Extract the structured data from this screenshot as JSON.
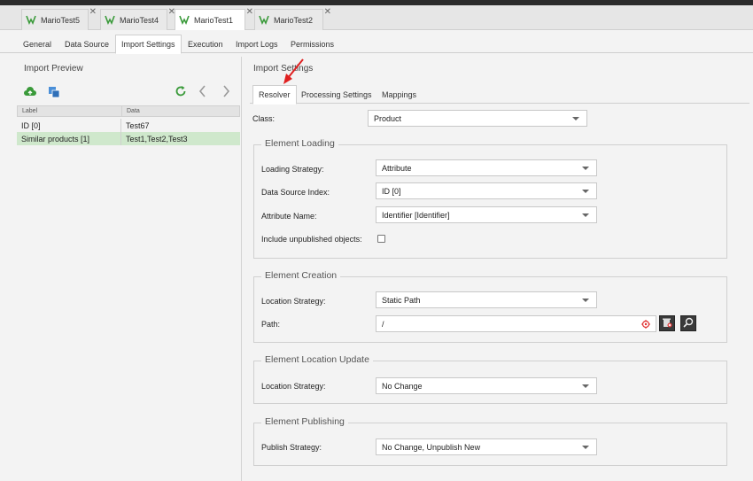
{
  "doc_tabs": [
    {
      "label": "MarioTest5"
    },
    {
      "label": "MarioTest4"
    },
    {
      "label": "MarioTest1"
    },
    {
      "label": "MarioTest2"
    }
  ],
  "sub_tabs": [
    {
      "label": "General"
    },
    {
      "label": "Data Source"
    },
    {
      "label": "Import Settings"
    },
    {
      "label": "Execution"
    },
    {
      "label": "Import Logs"
    },
    {
      "label": "Permissions"
    }
  ],
  "import_preview": {
    "title": "Import Preview",
    "columns": [
      "Label",
      "Data"
    ],
    "rows": [
      {
        "label": "ID [0]",
        "data": "Test67"
      },
      {
        "label": "Similar products [1]",
        "data": "Test1,Test2,Test3"
      }
    ]
  },
  "import_settings": {
    "title": "Import Settings",
    "tabs": [
      {
        "label": "Resolver"
      },
      {
        "label": "Processing Settings"
      },
      {
        "label": "Mappings"
      }
    ],
    "class_label": "Class:",
    "class_value": "Product",
    "element_loading": {
      "legend": "Element Loading",
      "loading_strategy_label": "Loading Strategy:",
      "loading_strategy_value": "Attribute",
      "data_source_index_label": "Data Source Index:",
      "data_source_index_value": "ID [0]",
      "attribute_name_label": "Attribute Name:",
      "attribute_name_value": "Identifier [Identifier]",
      "include_unpublished_label": "Include unpublished objects:"
    },
    "element_creation": {
      "legend": "Element Creation",
      "location_strategy_label": "Location Strategy:",
      "location_strategy_value": "Static Path",
      "path_label": "Path:",
      "path_value": "/"
    },
    "element_location_update": {
      "legend": "Element Location Update",
      "location_strategy_label": "Location Strategy:",
      "location_strategy_value": "No Change"
    },
    "element_publishing": {
      "legend": "Element Publishing",
      "publish_strategy_label": "Publish Strategy:",
      "publish_strategy_value": "No Change, Unpublish New"
    }
  },
  "colors": {
    "accent_green": "#3a9a3a",
    "selected_row": "#cfe8cc",
    "annotation_arrow": "#e02020"
  }
}
